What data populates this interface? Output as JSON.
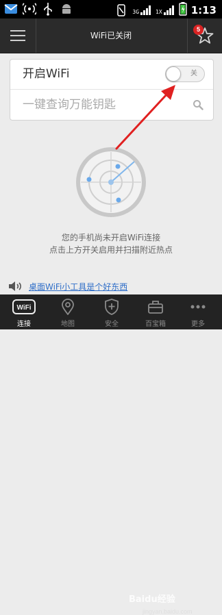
{
  "status_bar": {
    "time": "1:13",
    "network_3g": "3G",
    "network_1x": "1X",
    "icons": [
      "message-icon",
      "wifi-hotspot-icon",
      "usb-icon",
      "android-icon",
      "mute-icon",
      "signal-3g-icon",
      "signal-1x-icon",
      "battery-icon"
    ]
  },
  "header": {
    "title": "WiFi已关闭",
    "badge_count": "5"
  },
  "wifi": {
    "label": "开启WiFi",
    "toggle_text": "关",
    "enabled": false
  },
  "search": {
    "placeholder": "一键查询万能钥匙"
  },
  "messages": {
    "line1": "您的手机尚未开启WiFi连接",
    "line2": "点击上方开关启用并扫描附近热点"
  },
  "tip": {
    "text": "桌面WiFi小工具是个好东西"
  },
  "tabs": [
    {
      "label": "连接",
      "icon": "wifi-icon",
      "active": true
    },
    {
      "label": "地图",
      "icon": "map-pin-icon",
      "active": false
    },
    {
      "label": "安全",
      "icon": "shield-icon",
      "active": false
    },
    {
      "label": "百宝箱",
      "icon": "toolbox-icon",
      "active": false
    },
    {
      "label": "更多",
      "icon": "more-icon",
      "active": false
    }
  ],
  "watermark": {
    "text": "Baidu经验",
    "url_text": "jingyan.baidu.com"
  },
  "colors": {
    "header_bg": "#2b2b2b",
    "accent_link": "#2f6ec8",
    "annotation_arrow": "#e02020",
    "badge": "#d92323"
  }
}
